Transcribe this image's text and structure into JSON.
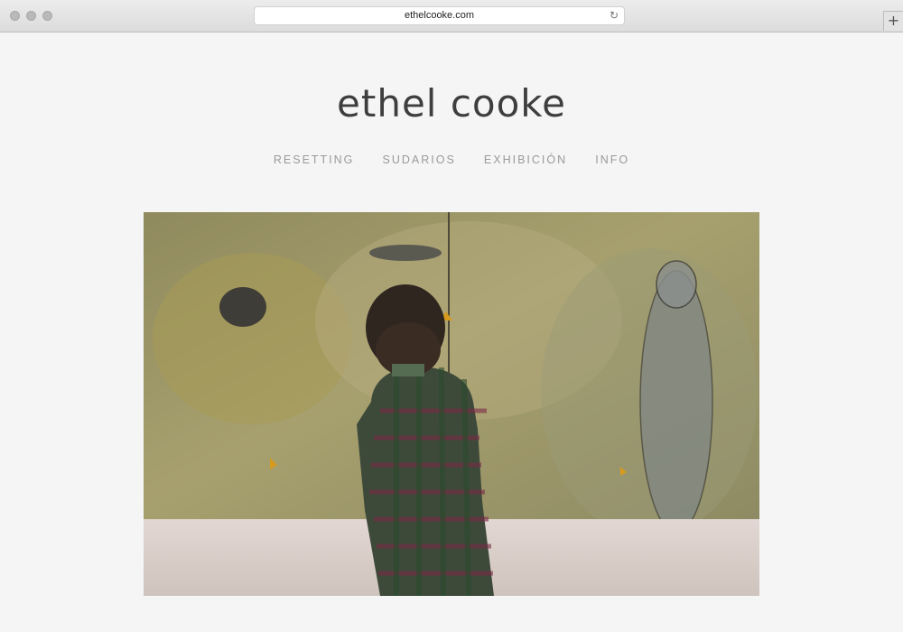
{
  "browser": {
    "url": "ethelcooke.com",
    "new_tab_symbol": "+",
    "reload_symbol": "↻"
  },
  "site": {
    "title": "ethel cooke",
    "nav": [
      "RESETTING",
      "SUDARIOS",
      "EXHIBICIÓN",
      "INFO"
    ]
  },
  "hero": {
    "description_icon": "gallery-photo"
  },
  "colors": {
    "page_background": "#f5f5f5",
    "title": "#3e3e3e",
    "nav": "#9a9a9a"
  }
}
